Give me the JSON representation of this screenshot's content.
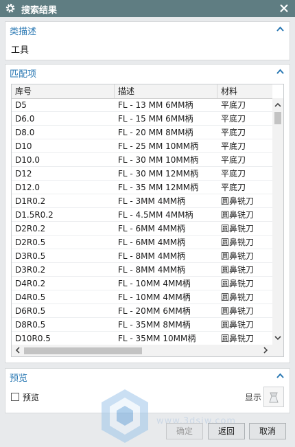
{
  "window": {
    "title": "搜索结果"
  },
  "category": {
    "title": "类描述",
    "value": "工具"
  },
  "matches": {
    "title": "匹配项",
    "columns": [
      "库号",
      "描述",
      "材料"
    ],
    "rows": [
      [
        "D5",
        "FL - 13 MM  6MM柄",
        "平底刀"
      ],
      [
        "D6.0",
        "FL - 15 MM  6MM柄",
        "平底刀"
      ],
      [
        "D8.0",
        "FL - 20 MM  8MM柄",
        "平底刀"
      ],
      [
        "D10",
        "FL - 25 MM  10MM柄",
        "平底刀"
      ],
      [
        "D10.0",
        "FL - 30 MM 10MM柄",
        "平底刀"
      ],
      [
        "D12",
        "FL - 30 MM 12MM柄",
        "平底刀"
      ],
      [
        "D12.0",
        "FL - 35 MM 12MM柄",
        "平底刀"
      ],
      [
        "D1R0.2",
        "FL - 3MM 4MM柄",
        "圆鼻铣刀"
      ],
      [
        "D1.5R0.2",
        "FL - 4.5MM 4MM柄",
        "圆鼻铣刀"
      ],
      [
        "D2R0.2",
        "FL - 6MM 4MM柄",
        "圆鼻铣刀"
      ],
      [
        "D2R0.5",
        "FL - 6MM 4MM柄",
        "圆鼻铣刀"
      ],
      [
        "D3R0.5",
        "FL - 8MM 4MM柄",
        "圆鼻铣刀"
      ],
      [
        "D3R0.2",
        "FL - 8MM 4MM柄",
        "圆鼻铣刀"
      ],
      [
        "D4R0.2",
        "FL - 10MM 4MM柄",
        "圆鼻铣刀"
      ],
      [
        "D4R0.5",
        "FL - 10MM 4MM柄",
        "圆鼻铣刀"
      ],
      [
        "D6R0.5",
        "FL - 20MM 6MM柄",
        "圆鼻铣刀"
      ],
      [
        "D8R0.5",
        "FL - 35MM 8MM柄",
        "圆鼻铣刀"
      ],
      [
        "D10R0.5",
        "FL - 35MM 10MM柄",
        "圆鼻铣刀"
      ]
    ]
  },
  "preview": {
    "title": "预览",
    "checkbox_label": "预览",
    "show_label": "显示"
  },
  "buttons": {
    "ok": "确定",
    "back": "返回",
    "cancel": "取消"
  },
  "watermark": {
    "text": "www.3dsjw.com"
  },
  "colors": {
    "titlebar": "#5f7d82",
    "section_title": "#2a78b3"
  },
  "icons": {
    "title": "gear-icon",
    "close": "close-icon",
    "collapse": "chevron-up-icon",
    "show": "preview-show-icon"
  }
}
